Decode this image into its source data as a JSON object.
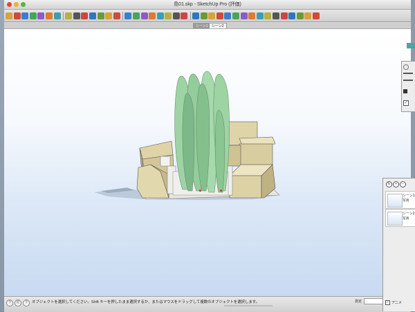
{
  "window": {
    "title": "島01.skp - SketchUp Pro (評価)"
  },
  "toolbar": {
    "icons": [
      "select-icon",
      "eraser-icon",
      "paint-bucket-icon",
      "orbit-icon",
      "pan-icon",
      "zoom-icon",
      "zoom-window-icon",
      "zoom-extents-icon",
      "line-icon",
      "arc-icon",
      "rectangle-icon",
      "circle-icon",
      "polygon-icon",
      "push-pull-icon",
      "move-icon",
      "rotate-icon",
      "scale-icon",
      "offset-icon",
      "follow-me-icon",
      "tape-icon",
      "protractor-icon",
      "text-icon",
      "axes-icon",
      "3d-text-icon",
      "walk-icon",
      "look-around-icon",
      "position-camera-icon",
      "section-icon",
      "components-icon",
      "materials-icon",
      "styles-icon",
      "layers-icon",
      "scenes-icon",
      "shadows-icon",
      "fog-icon",
      "match-photo-icon",
      "sandbox-icon",
      "warehouse-icon"
    ]
  },
  "scenes": {
    "tabs": [
      "シーン1",
      "シーン2"
    ],
    "active_index": 0
  },
  "status": {
    "message": "オブジェクトを選択してください。Shift キーを押したまま選択するか、またはマウスをドラッグして複数のオブジェクトを選択します。",
    "measure_label": "測定"
  },
  "scenes_panel": {
    "items": [
      {
        "name": "シーン1",
        "sub": "写真"
      },
      {
        "name": "シーン2",
        "sub": "写真"
      }
    ],
    "checkbox_label": "アニメ"
  },
  "colors": {
    "tree": "#9ed3a4",
    "tree_shade": "#7cb889",
    "building": "#dfd4a8",
    "building_shade": "#cbbd8c",
    "building_side": "#b8ab7c",
    "sky_top": "#ffffff",
    "sky_bottom": "#c8daf1"
  }
}
